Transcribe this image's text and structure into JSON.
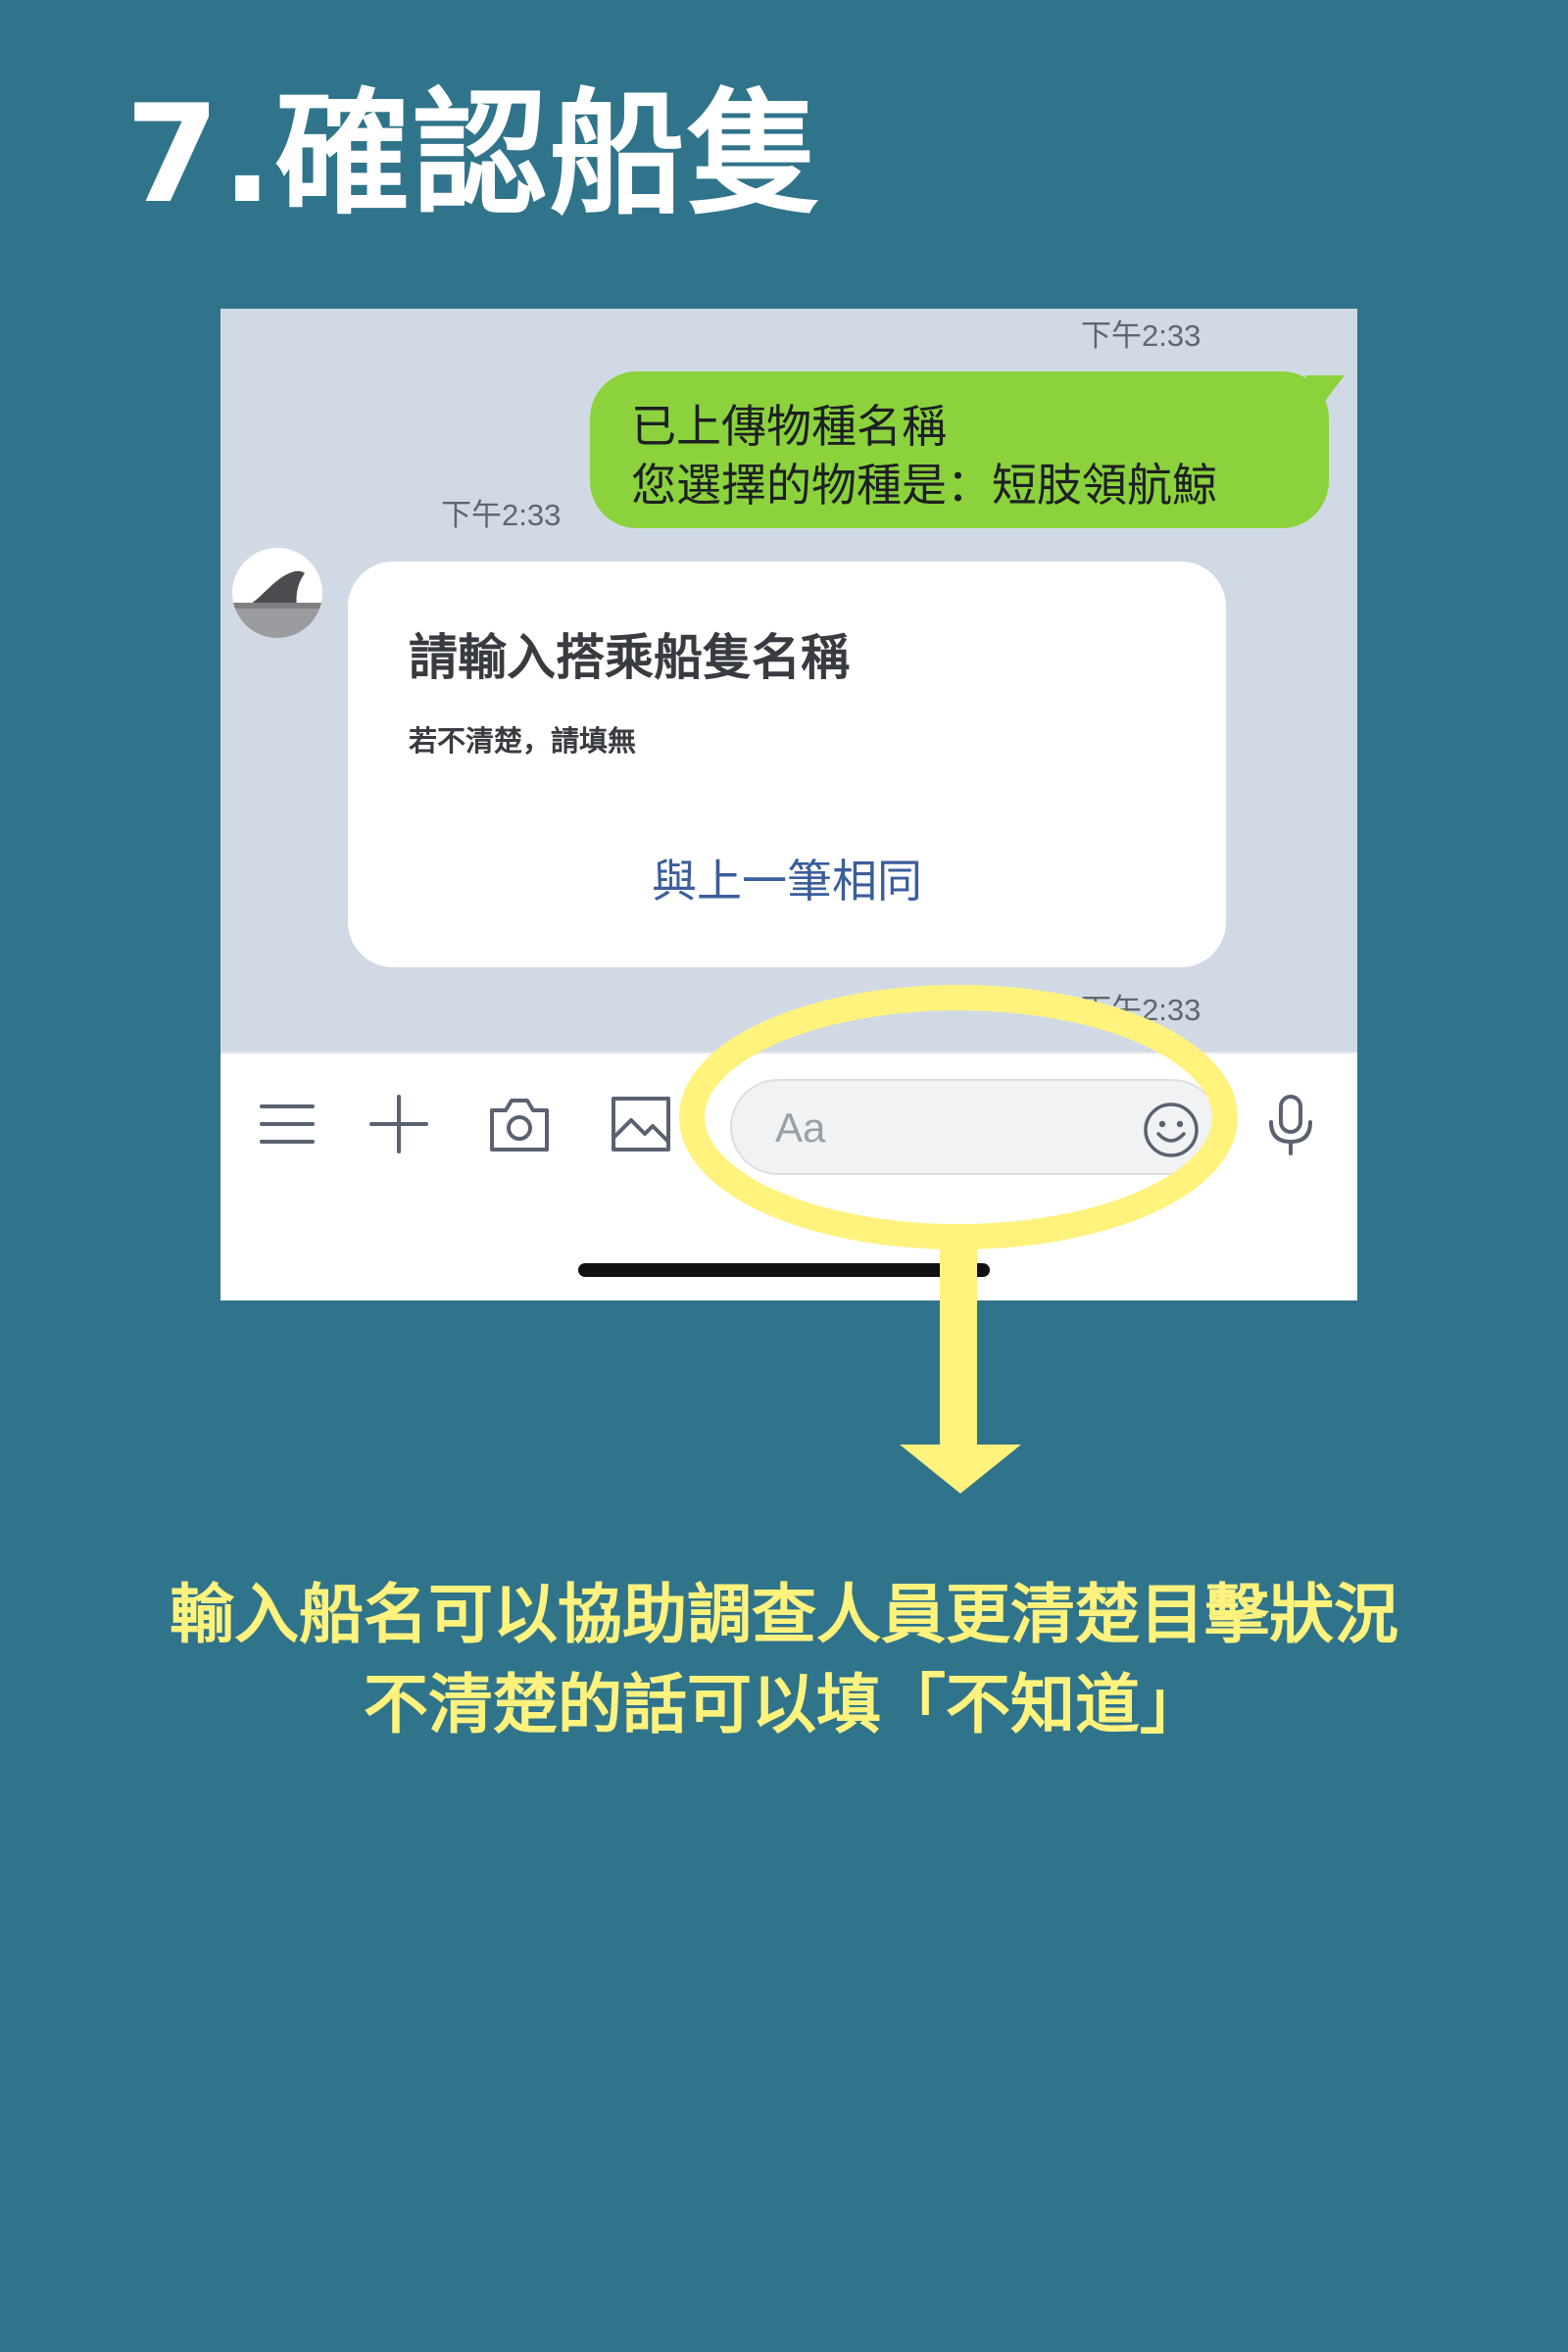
{
  "page": {
    "title": "7.確認船隻",
    "caption_lines": [
      "輸入船名可以協助調查人員更清楚目擊狀況",
      "不清楚的話可以填「不知道」"
    ]
  },
  "chat": {
    "timestamps": {
      "top": "下午2:33",
      "outgoing": "下午2:33",
      "bottom": "下午2:33"
    },
    "outgoing_message": {
      "lines": [
        "已上傳物種名稱",
        "您選擇的物種是：短肢領航鯨"
      ]
    },
    "bot_card": {
      "title": "請輸入搭乘船隻名稱",
      "subtitle": "若不清楚，請填無",
      "action_label": "與上一筆相同"
    },
    "avatar_icon": "whale-fin-icon"
  },
  "input_bar": {
    "placeholder": "Aa",
    "icons": [
      "menu-icon",
      "plus-icon",
      "camera-icon",
      "image-icon",
      "emoji-icon",
      "microphone-icon"
    ]
  },
  "colors": {
    "background": "#30748b",
    "chat_background": "#d1dae4",
    "outgoing_bubble": "#8bd23c",
    "highlight": "#fff27d",
    "action_link": "#3b5e9c"
  }
}
